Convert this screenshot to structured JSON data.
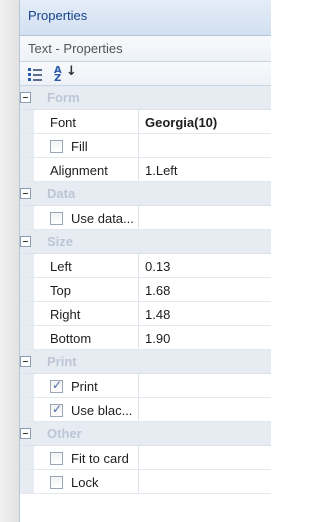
{
  "panel": {
    "title": "Properties",
    "object_label": "Text - Properties"
  },
  "toolbar": {
    "categorized_icon": "categorized-view-icon",
    "sort_icon": "sort-az-icon"
  },
  "categories": [
    {
      "label": "Form",
      "rows": [
        {
          "name": "Font",
          "value": "Georgia(10)",
          "checkbox": null
        },
        {
          "name": "Fill",
          "value": "",
          "checkbox": false
        },
        {
          "name": "Alignment",
          "value": "1.Left",
          "checkbox": null
        }
      ]
    },
    {
      "label": "Data",
      "rows": [
        {
          "name": "Use data...",
          "value": "",
          "checkbox": false
        }
      ]
    },
    {
      "label": "Size",
      "rows": [
        {
          "name": "Left",
          "value": "0.13",
          "checkbox": null
        },
        {
          "name": "Top",
          "value": "1.68",
          "checkbox": null
        },
        {
          "name": "Right",
          "value": "1.48",
          "checkbox": null
        },
        {
          "name": "Bottom",
          "value": "1.90",
          "checkbox": null
        }
      ]
    },
    {
      "label": "Print",
      "rows": [
        {
          "name": "Print",
          "value": "",
          "checkbox": true
        },
        {
          "name": "Use blac...",
          "value": "",
          "checkbox": true
        }
      ]
    },
    {
      "label": "Other",
      "rows": [
        {
          "name": "Fit to card",
          "value": "",
          "checkbox": false
        },
        {
          "name": "Lock",
          "value": "",
          "checkbox": false
        }
      ]
    }
  ]
}
